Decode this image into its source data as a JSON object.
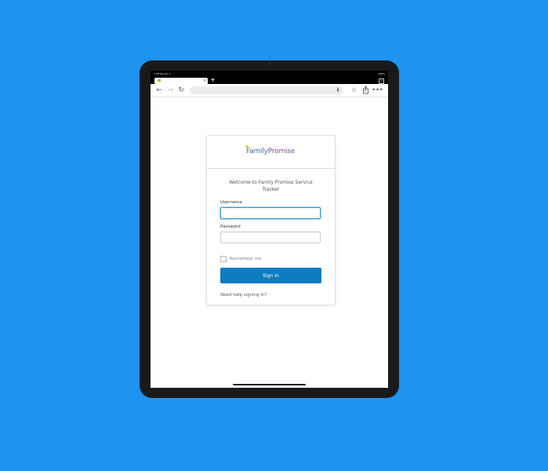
{
  "status_bar": {
    "time": "7:08  Tue Jun 1",
    "battery": "100%"
  },
  "browser": {
    "tab_close": "×",
    "new_tab": "+",
    "tab_count": "1",
    "icons": {
      "back": "arrow-left-icon",
      "forward": "arrow-right-icon",
      "reload": "reload-icon",
      "mic": "microphone-icon",
      "star": "star-icon",
      "share": "share-icon",
      "more": "more-icon"
    }
  },
  "login": {
    "logo_family": "Family",
    "logo_promise": "Promise",
    "welcome": "Welcome to Family Promise Service Tracker",
    "username_label": "Username",
    "username_value": "",
    "password_label": "Password",
    "password_value": "",
    "remember_label": "Remember me",
    "signin_label": "Sign In",
    "help_link": "Need help signing in?"
  },
  "colors": {
    "background": "#1e93f0",
    "primary_button": "#0f7cc1",
    "logo_blue": "#3e6fa8",
    "logo_purple": "#7d4f8f"
  }
}
